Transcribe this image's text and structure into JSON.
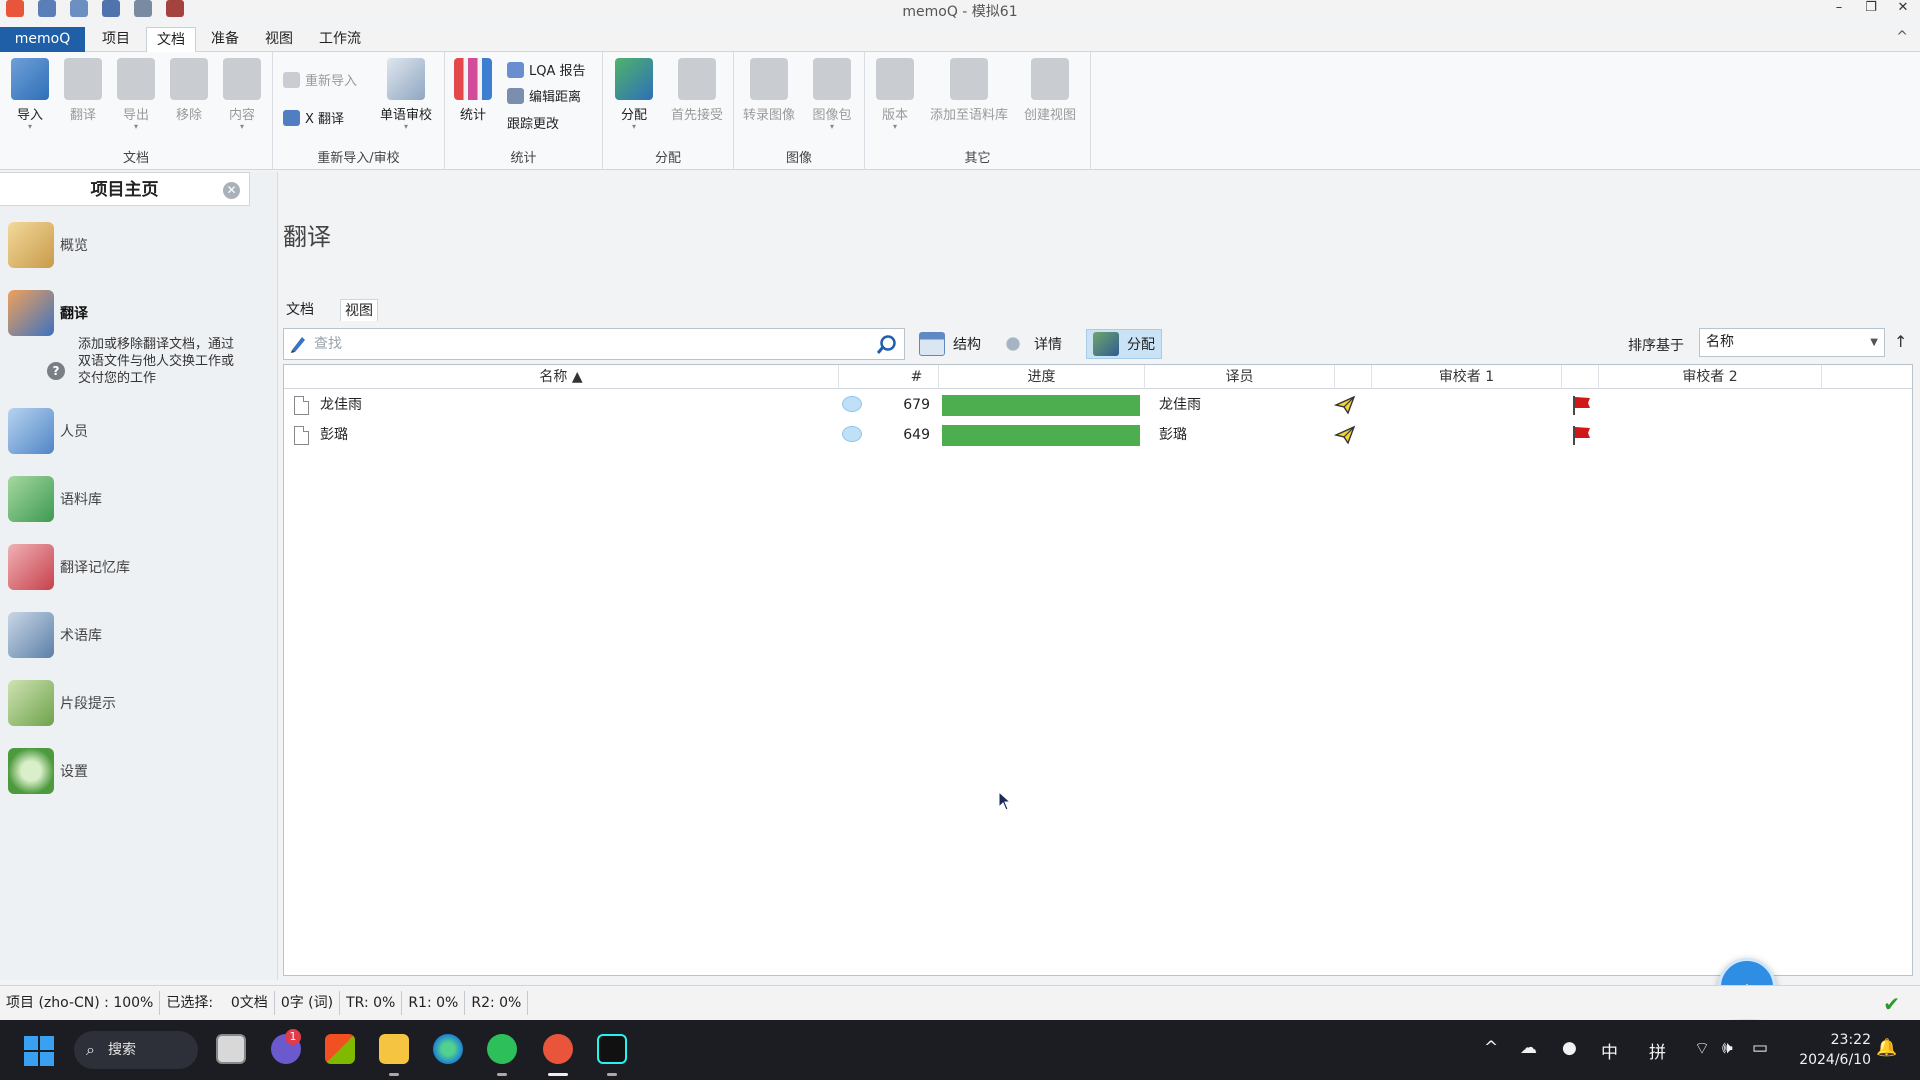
{
  "window": {
    "title": "memoQ - 模拟61",
    "minimize": "–",
    "restore": "❐",
    "close": "✕"
  },
  "menu": {
    "app": "memoQ",
    "tabs": [
      "项目",
      "文档",
      "准备",
      "视图",
      "工作流"
    ],
    "active_tab": "文档",
    "collapse": "^"
  },
  "ribbon": {
    "groups": {
      "doc": "文档",
      "reimport": "重新导入/审校",
      "stats": "统计",
      "assign": "分配",
      "image": "图像",
      "other": "其它"
    },
    "buttons": {
      "import": "导入",
      "translate": "翻译",
      "export": "导出",
      "remove": "移除",
      "content": "内容",
      "reimport": "重新导入",
      "x_translate": "X 翻译",
      "monolingual_review": "单语审校",
      "statistics": "统计",
      "lqa_report": "LQA 报告",
      "edit_distance": "编辑距离",
      "track_changes": "跟踪更改",
      "assign": "分配",
      "first_accept": "首先接受",
      "transcribe_image": "转录图像",
      "image_package": "图像包",
      "version": "版本",
      "add_to_corpus": "添加至语料库",
      "create_view": "创建视图"
    }
  },
  "left_panel": {
    "header": "项目主页",
    "close": "✕",
    "items": [
      {
        "label": "概览"
      },
      {
        "label": "翻译"
      },
      {
        "label": "人员"
      },
      {
        "label": "语料库"
      },
      {
        "label": "翻译记忆库"
      },
      {
        "label": "术语库"
      },
      {
        "label": "片段提示"
      },
      {
        "label": "设置"
      }
    ],
    "active_item": "翻译",
    "active_desc": "添加或移除翻译文档，通过双语文件与他人交换工作或交付您的工作",
    "help": "?"
  },
  "main": {
    "title": "翻译",
    "subtabs": [
      "文档",
      "视图"
    ],
    "search_placeholder": "查找",
    "view_buttons": {
      "structure": "结构",
      "details": "详情",
      "assign": "分配"
    },
    "sort_label": "排序基于",
    "sort_value": "名称",
    "sort_direction": "↑",
    "columns": {
      "name": "名称 ▲",
      "count": "#",
      "progress": "进度",
      "translator": "译员",
      "reviewer1": "审校者 1",
      "reviewer2": "审校者 2"
    },
    "rows": [
      {
        "name": "龙佳雨",
        "count": "679",
        "progress": 1.0,
        "translator": "龙佳雨"
      },
      {
        "name": "彭璐",
        "count": "649",
        "progress": 1.0,
        "translator": "彭璐"
      }
    ]
  },
  "statusbar": {
    "cells": [
      "项目 (zho-CN) : 100%",
      "已选择:    0文档",
      "0字 (词)",
      "TR: 0%",
      "R1: 0%",
      "R2: 0%"
    ]
  },
  "taskbar": {
    "search": "搜索",
    "badge": "1",
    "tray": {
      "chevron": "^",
      "ime_lang": "中",
      "ime_mode": "拼"
    },
    "time": "23:22",
    "date": "2024/6/10"
  },
  "colors": {
    "accent": "#1e5fa8",
    "progress": "#4cae4f",
    "flag": "#d01818",
    "selected_tool": "#c9e2f5"
  }
}
